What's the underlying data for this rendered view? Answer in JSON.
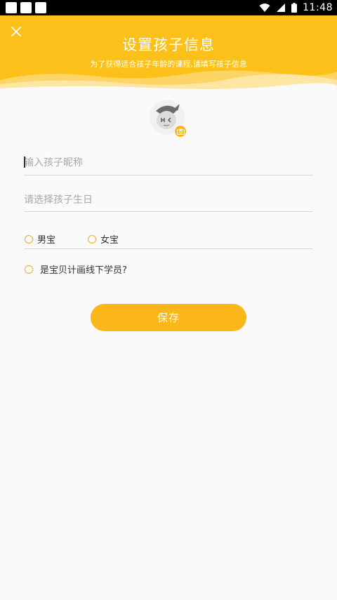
{
  "status_bar": {
    "time": "11:48"
  },
  "header": {
    "title": "设置孩子信息",
    "subtitle": "为了获得适合孩子年龄的课程,请填写孩子信息",
    "close_icon": "close-icon"
  },
  "avatar": {
    "icon": "avatar-placeholder-icon",
    "badge_icon": "camera-icon"
  },
  "form": {
    "nickname_placeholder": "输入孩子昵称",
    "birthday_placeholder": "请选择孩子生日",
    "gender_options": [
      "男宝",
      "女宝"
    ],
    "offline_question": "是宝贝计画线下学员?"
  },
  "actions": {
    "save_label": "保存"
  },
  "colors": {
    "accent": "#fbb61a",
    "header_bg": "#fcc01a",
    "radio_ring": "#f5a623",
    "background": "#fafafa"
  }
}
